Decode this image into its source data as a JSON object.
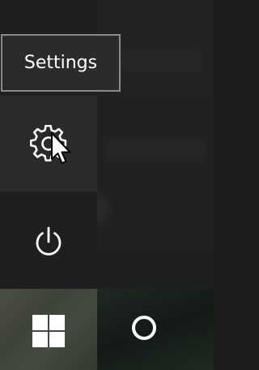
{
  "tooltip": {
    "text": "Settings"
  },
  "icons": {
    "settings": "gear-icon",
    "power": "power-icon",
    "start": "windows-logo-icon",
    "search": "cortana-circle-icon",
    "pointer": "mouse-cursor-icon"
  },
  "colors": {
    "panel_bg": "#202020",
    "settings_hover_bg": "#2b2b2b",
    "tooltip_border": "#8a8a8a",
    "icon": "#ffffff"
  }
}
